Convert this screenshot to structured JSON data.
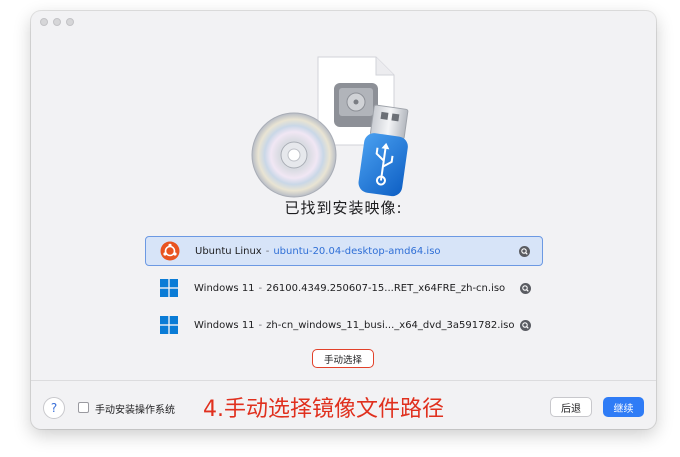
{
  "window": {
    "traffic_lights": [
      "close",
      "minimize",
      "zoom"
    ]
  },
  "headline": "已找到安装映像:",
  "images": [
    {
      "name": "Ubuntu Linux",
      "separator": "-",
      "file": "ubuntu-20.04-desktop-amd64.iso",
      "os_icon": "ubuntu-icon",
      "selected": true
    },
    {
      "name": "Windows 11",
      "separator": "-",
      "file": "26100.4349.250607-15...RET_x64FRE_zh-cn.iso",
      "os_icon": "windows-icon",
      "selected": false
    },
    {
      "name": "Windows 11",
      "separator": "-",
      "file": "zh-cn_windows_11_busi..._x64_dvd_3a591782.iso",
      "os_icon": "windows-icon",
      "selected": false
    }
  ],
  "manual_select_label": "手动选择",
  "footer": {
    "help_label": "?",
    "manual_install_label": "手动安装操作系统",
    "annotation": "4.手动选择镜像文件路径",
    "back_label": "后退",
    "continue_label": "继续"
  },
  "colors": {
    "accent": "#2f7cf6",
    "selection_bg": "#d7e4f8",
    "highlight_red": "#e2412a",
    "ubuntu_orange": "#e95420",
    "windows_blue": "#0a7cd6"
  }
}
